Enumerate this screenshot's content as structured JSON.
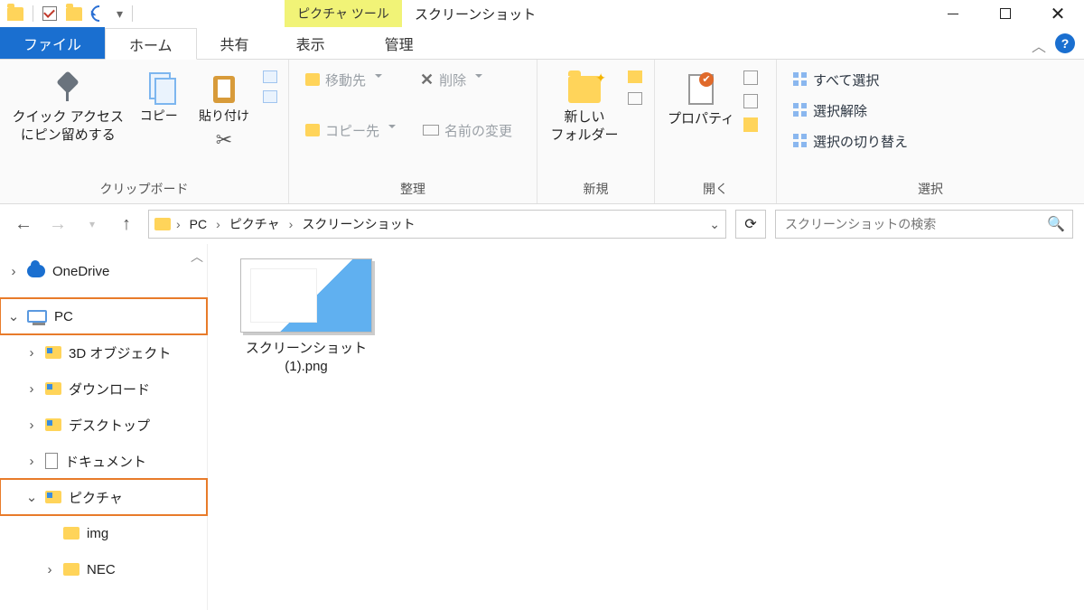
{
  "titlebar": {
    "tools_tab": "ピクチャ ツール",
    "title": "スクリーンショット"
  },
  "tabs": {
    "file": "ファイル",
    "home": "ホーム",
    "share": "共有",
    "view": "表示",
    "manage": "管理"
  },
  "ribbon": {
    "clipboard": {
      "label": "クリップボード",
      "pin": "クイック アクセス\nにピン留めする",
      "copy": "コピー",
      "paste": "貼り付け"
    },
    "organize": {
      "label": "整理",
      "move": "移動先",
      "copy_to": "コピー先",
      "delete": "削除",
      "rename": "名前の変更"
    },
    "new": {
      "label": "新規",
      "new_folder": "新しい\nフォルダー"
    },
    "open": {
      "label": "開く",
      "properties": "プロパティ"
    },
    "select": {
      "label": "選択",
      "all": "すべて選択",
      "none": "選択解除",
      "invert": "選択の切り替え"
    }
  },
  "breadcrumb": {
    "pc": "PC",
    "pictures": "ピクチャ",
    "screenshots": "スクリーンショット"
  },
  "search": {
    "placeholder": "スクリーンショットの検索"
  },
  "tree": {
    "onedrive": "OneDrive",
    "pc": "PC",
    "obj3d": "3D オブジェクト",
    "downloads": "ダウンロード",
    "desktop": "デスクトップ",
    "documents": "ドキュメント",
    "pictures": "ピクチャ",
    "img": "img",
    "nec": "NEC"
  },
  "file": {
    "name": "スクリーンショット (1).png"
  }
}
